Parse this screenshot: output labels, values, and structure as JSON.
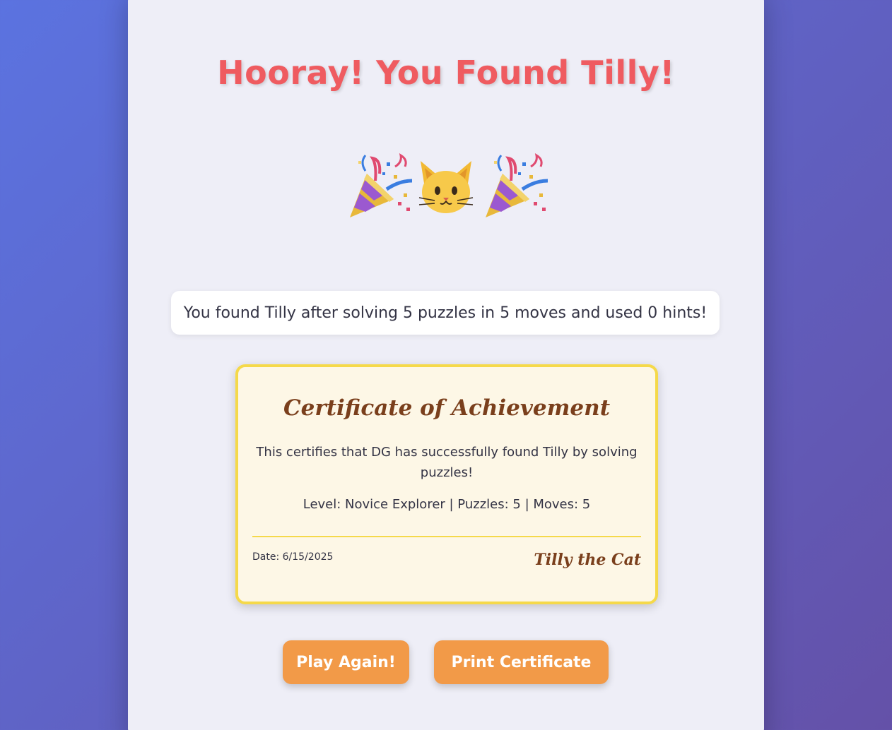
{
  "title": "Hooray! You Found Tilly!",
  "celebration": {
    "left_icon": "party-popper-icon",
    "center_icon": "cat-face-icon",
    "right_icon": "party-popper-icon"
  },
  "summary": {
    "text": "You found Tilly after solving 5 puzzles in 5 moves and used 0 hints!",
    "puzzles": 5,
    "moves": 5,
    "hints": 0
  },
  "certificate": {
    "title": "Certificate of Achievement",
    "body": "This certifies that DG has successfully found Tilly by solving puzzles!",
    "stats": "Level: Novice Explorer | Puzzles: 5 | Moves: 5",
    "date": "Date: 6/15/2025",
    "signature": "Tilly the Cat"
  },
  "buttons": {
    "play_again": "Play Again!",
    "print_certificate": "Print Certificate"
  },
  "colors": {
    "title": "#ef5b60",
    "accent_button": "#f29a48",
    "certificate_border": "#f5d94a",
    "certificate_text": "#7a3f1c"
  }
}
